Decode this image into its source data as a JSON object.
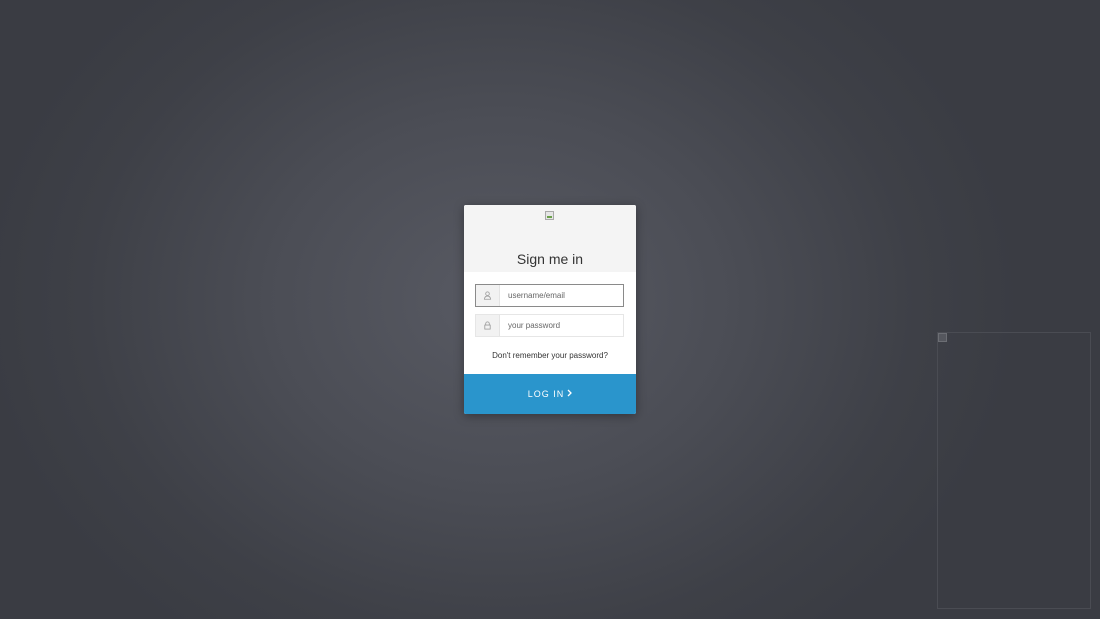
{
  "login": {
    "title": "Sign me in",
    "username": {
      "placeholder": "username/email",
      "value": ""
    },
    "password": {
      "placeholder": "your password",
      "value": ""
    },
    "forgot_link": "Don't remember your password?",
    "submit_label": "Log in"
  },
  "icons": {
    "user": "user-icon",
    "lock": "lock-icon",
    "chevron": "chevron-right-icon",
    "logo": "broken-image-icon"
  },
  "colors": {
    "accent": "#2a95cc",
    "background": "#4b4d55",
    "card": "#ffffff",
    "card_header": "#f4f4f4"
  }
}
